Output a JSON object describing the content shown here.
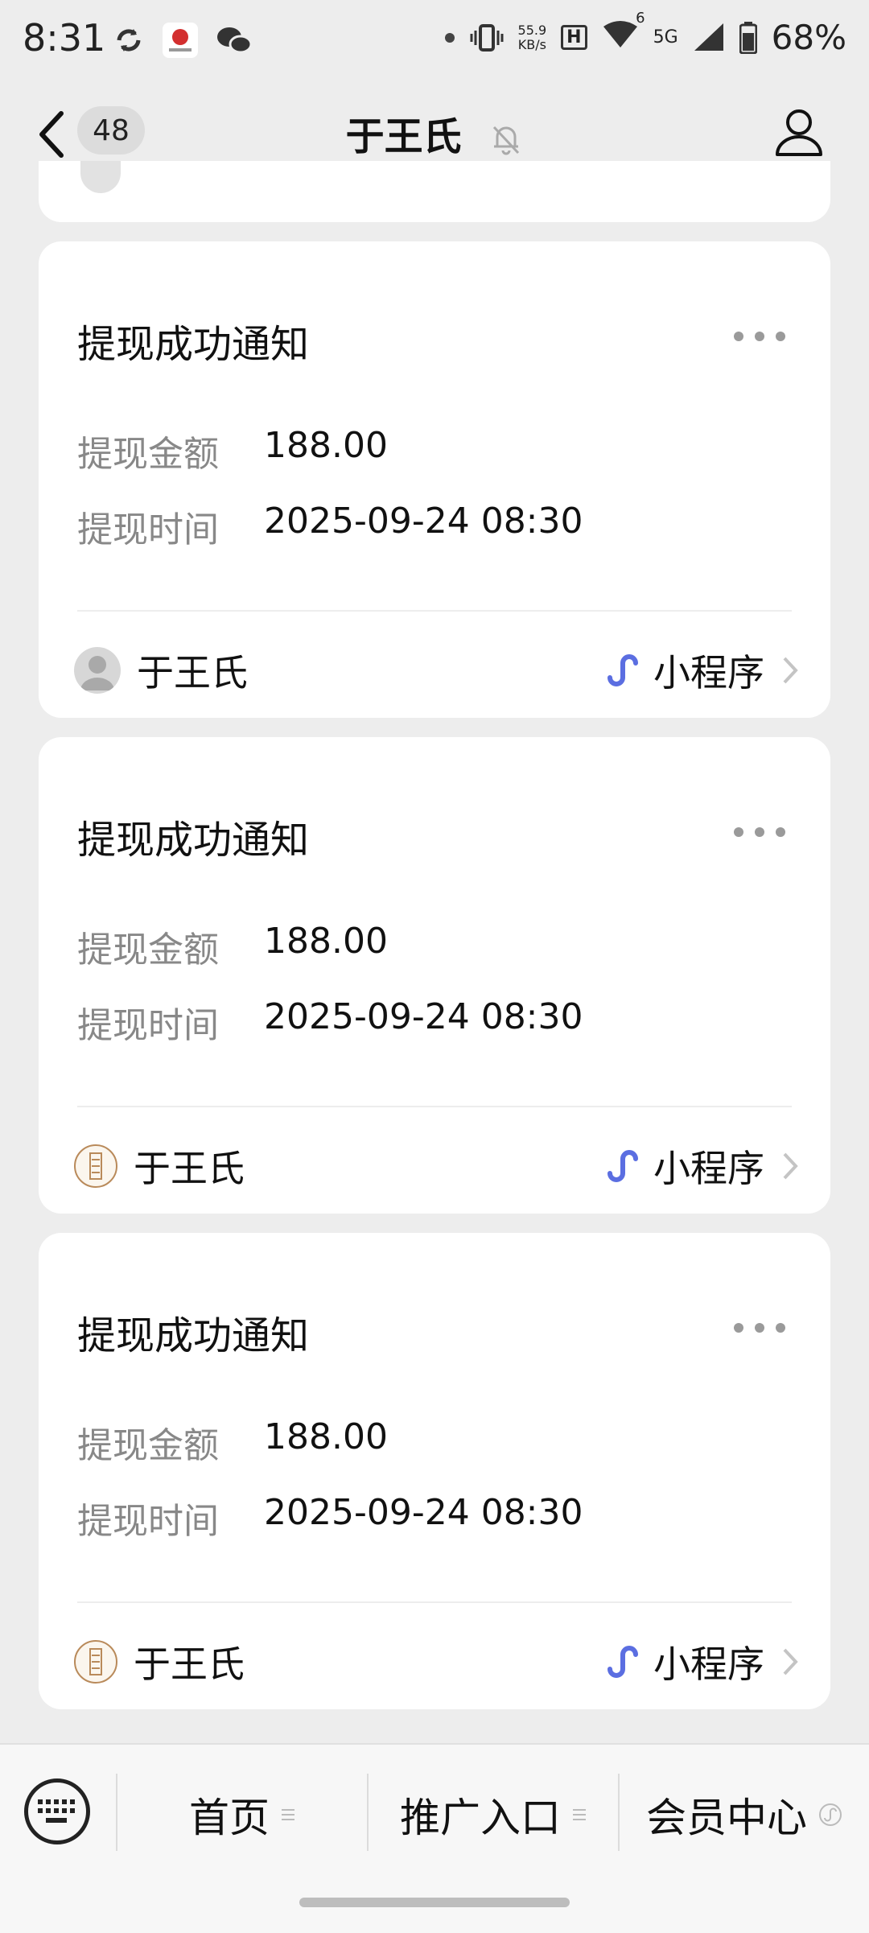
{
  "status_bar": {
    "time": "8:31",
    "net_speed_value": "55.9",
    "net_speed_unit": "KB/s",
    "hd_badge": "H",
    "wifi_sup": "6",
    "network": "5G",
    "battery": "68%"
  },
  "header": {
    "unread_count": "48",
    "title": "于王氏"
  },
  "cards": [
    {
      "title": "提现成功通知",
      "amount_label": "提现金额",
      "amount_value": "188.00",
      "time_label": "提现时间",
      "time_value": "2025-09-24 08:30",
      "account_name": "于王氏",
      "mini_program_label": "小程序"
    },
    {
      "title": "提现成功通知",
      "amount_label": "提现金额",
      "amount_value": "188.00",
      "time_label": "提现时间",
      "time_value": "2025-09-24 08:30",
      "account_name": "于王氏",
      "mini_program_label": "小程序"
    },
    {
      "title": "提现成功通知",
      "amount_label": "提现金额",
      "amount_value": "188.00",
      "time_label": "提现时间",
      "time_value": "2025-09-24 08:30",
      "account_name": "于王氏",
      "mini_program_label": "小程序"
    }
  ],
  "menu": {
    "items": [
      {
        "label": "首页",
        "icon": "list-icon"
      },
      {
        "label": "推广入口",
        "icon": "list-icon"
      },
      {
        "label": "会员中心",
        "icon": "mini-program-icon"
      }
    ]
  },
  "colors": {
    "background": "#ededed",
    "card": "#ffffff",
    "label_gray": "#888888",
    "mini_program_blue": "#5b6ee1"
  }
}
